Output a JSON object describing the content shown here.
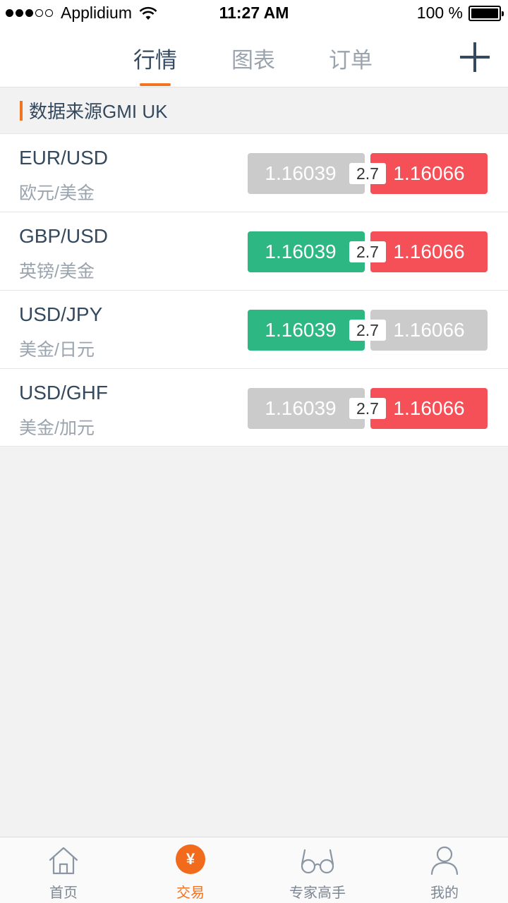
{
  "status_bar": {
    "carrier": "Applidium",
    "time": "11:27 AM",
    "battery": "100 %",
    "signal_bars_filled": 3,
    "signal_bars_total": 5
  },
  "header": {
    "tabs": [
      {
        "label": "行情",
        "active": true
      },
      {
        "label": "图表",
        "active": false
      },
      {
        "label": "订单",
        "active": false
      }
    ],
    "add_icon": "plus-icon"
  },
  "source": {
    "label": "数据来源GMI UK"
  },
  "quotes": [
    {
      "code": "EUR/USD",
      "name": "欧元/美金",
      "bid": "1.16039",
      "bid_state": "gray",
      "spread": "2.7",
      "ask": "1.16066",
      "ask_state": "red"
    },
    {
      "code": "GBP/USD",
      "name": "英镑/美金",
      "bid": "1.16039",
      "bid_state": "green",
      "spread": "2.7",
      "ask": "1.16066",
      "ask_state": "red"
    },
    {
      "code": "USD/JPY",
      "name": "美金/日元",
      "bid": "1.16039",
      "bid_state": "green",
      "spread": "2.7",
      "ask": "1.16066",
      "ask_state": "gray"
    },
    {
      "code": "USD/GHF",
      "name": "美金/加元",
      "bid": "1.16039",
      "bid_state": "gray",
      "spread": "2.7",
      "ask": "1.16066",
      "ask_state": "red"
    }
  ],
  "bottom_nav": [
    {
      "label": "首页",
      "icon": "home-icon",
      "active": false
    },
    {
      "label": "交易",
      "icon": "yen-icon",
      "icon_glyph": "¥",
      "active": true
    },
    {
      "label": "专家高手",
      "icon": "glasses-icon",
      "active": false
    },
    {
      "label": "我的",
      "icon": "user-icon",
      "active": false
    }
  ],
  "colors": {
    "accent": "#f27322",
    "up": "#2db783",
    "down": "#f55058",
    "neutral": "#cbcbcb",
    "text_primary": "#34495e",
    "text_secondary": "#9aa4ae"
  }
}
